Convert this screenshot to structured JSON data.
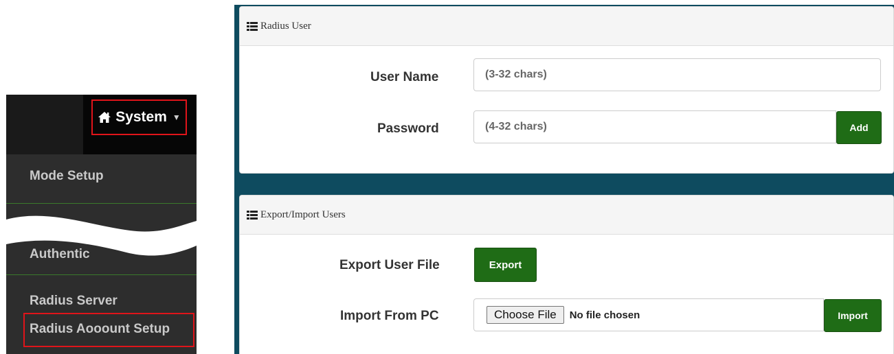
{
  "menu": {
    "system_label": "System",
    "items": [
      {
        "label": "Mode Setup"
      },
      {
        "label": "Authentic"
      },
      {
        "label": "Radius Server"
      },
      {
        "label": "Radius Aooount Setup"
      }
    ],
    "colors": {
      "highlight_border": "#e0141a",
      "divider": "#3a7a2c"
    }
  },
  "radius_user": {
    "title": "Radius User",
    "username_label": "User Name",
    "username_placeholder": "(3-32 chars)",
    "password_label": "Password",
    "password_placeholder": "(4-32 chars)",
    "add_label": "Add"
  },
  "export_import": {
    "title": "Export/Import Users",
    "export_label": "Export User File",
    "export_button": "Export",
    "import_label": "Import From PC",
    "choose_file": "Choose File",
    "file_status": "No file chosen",
    "import_button": "Import"
  },
  "colors": {
    "accent_green": "#1f6c16",
    "background_teal": "#0e4b5f"
  }
}
